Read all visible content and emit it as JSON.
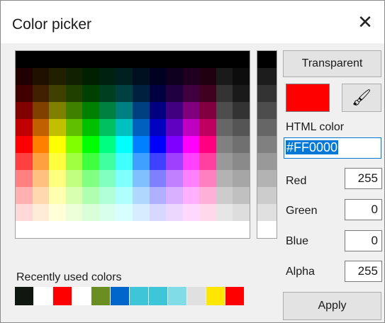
{
  "title": "Color picker",
  "close_glyph": "✕",
  "palette_colors": [
    [
      "#000000",
      "#000000",
      "#000000",
      "#000000",
      "#000000",
      "#000000",
      "#000000",
      "#000000",
      "#000000",
      "#000000",
      "#000000",
      "#000000",
      "#000000",
      "#000000"
    ],
    [
      "#200000",
      "#201000",
      "#202000",
      "#102000",
      "#002000",
      "#002010",
      "#002020",
      "#001020",
      "#000020",
      "#100020",
      "#200020",
      "#200010",
      "#1a1a1a",
      "#0d0d0d"
    ],
    [
      "#400000",
      "#402000",
      "#404000",
      "#204000",
      "#004000",
      "#004020",
      "#004040",
      "#002040",
      "#000040",
      "#200040",
      "#400040",
      "#400020",
      "#333333",
      "#1a1a1a"
    ],
    [
      "#800000",
      "#804000",
      "#808000",
      "#408000",
      "#008000",
      "#008040",
      "#008080",
      "#004080",
      "#000080",
      "#400080",
      "#800080",
      "#800040",
      "#4d4d4d",
      "#333333"
    ],
    [
      "#c00000",
      "#c06000",
      "#c0c000",
      "#60c000",
      "#00c000",
      "#00c060",
      "#00c0c0",
      "#0060c0",
      "#0000c0",
      "#6000c0",
      "#c000c0",
      "#c00060",
      "#666666",
      "#555555"
    ],
    [
      "#ff0000",
      "#ff8000",
      "#ffff00",
      "#80ff00",
      "#00ff00",
      "#00ff80",
      "#00ffff",
      "#0080ff",
      "#0000ff",
      "#8000ff",
      "#ff00ff",
      "#ff0080",
      "#808080",
      "#707070"
    ],
    [
      "#ff4040",
      "#ffa040",
      "#ffff40",
      "#a0ff40",
      "#40ff40",
      "#40ffa0",
      "#40ffff",
      "#40a0ff",
      "#4040ff",
      "#a040ff",
      "#ff40ff",
      "#ff40a0",
      "#999999",
      "#8a8a8a"
    ],
    [
      "#ff8080",
      "#ffc080",
      "#ffff80",
      "#c0ff80",
      "#80ff80",
      "#80ffc0",
      "#80ffff",
      "#80c0ff",
      "#8080ff",
      "#c080ff",
      "#ff80ff",
      "#ff80c0",
      "#b3b3b3",
      "#a6a6a6"
    ],
    [
      "#ffb0b0",
      "#ffd8b0",
      "#ffffb0",
      "#d8ffb0",
      "#b0ffb0",
      "#b0ffd8",
      "#b0ffff",
      "#b0d8ff",
      "#b0b0ff",
      "#d8b0ff",
      "#ffb0ff",
      "#ffb0d8",
      "#cccccc",
      "#c0c0c0"
    ],
    [
      "#ffd8d8",
      "#ffecd8",
      "#ffffd8",
      "#ecffd8",
      "#d8ffd8",
      "#d8ffec",
      "#d8ffff",
      "#d8ecff",
      "#d8d8ff",
      "#ecd8ff",
      "#ffd8ff",
      "#ffd8ec",
      "#e6e6e6",
      "#dddddd"
    ]
  ],
  "gray_strip": [
    "#000000",
    "#1c1c1c",
    "#333333",
    "#4d4d4d",
    "#666666",
    "#808080",
    "#999999",
    "#b3b3b3",
    "#cccccc",
    "#e0e0e0",
    "#ffffff"
  ],
  "recent": {
    "label": "Recently used colors",
    "colors": [
      "#101610",
      "#ffffff",
      "#ff0000",
      "#ffffff",
      "#6b8e23",
      "#0066cc",
      "#3ec6d8",
      "#3ec6d8",
      "#80dde8",
      "#e0e0e0",
      "#ffe600",
      "#ff0000"
    ]
  },
  "transparent_label": "Transparent",
  "current_color": "#ff0000",
  "eyedropper_glyph": "🖌",
  "html_color": {
    "label": "HTML color",
    "value": "#FF0000"
  },
  "channels": {
    "red": {
      "label": "Red",
      "value": "255"
    },
    "green": {
      "label": "Green",
      "value": "0"
    },
    "blue": {
      "label": "Blue",
      "value": "0"
    },
    "alpha": {
      "label": "Alpha",
      "value": "255"
    }
  },
  "apply_label": "Apply"
}
